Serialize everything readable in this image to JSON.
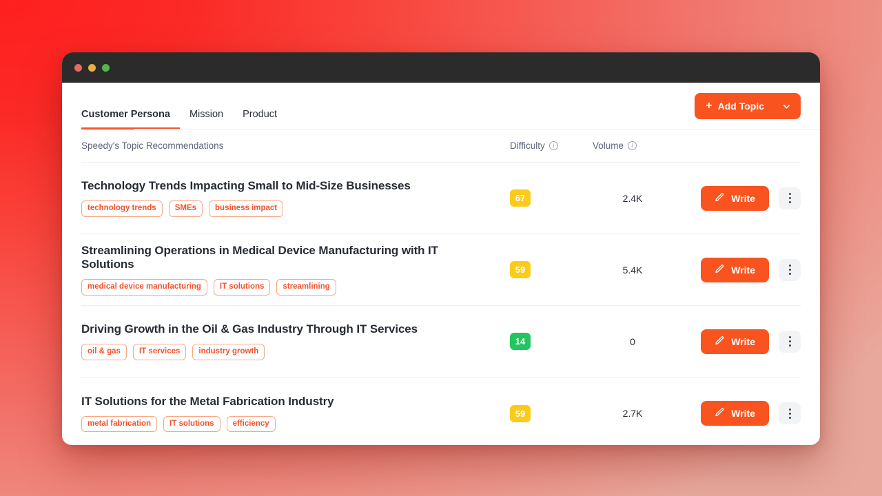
{
  "theme": {
    "accent": "#f9531f",
    "tag_border": "#f7a882",
    "tag_text": "#f4512a",
    "badge_yellow": "#fbcb1b",
    "badge_green": "#23c55e",
    "titlebar": "#2b2b2b",
    "bg_gradient_from": "#ff1f1f",
    "bg_gradient_to": "#e8a99c"
  },
  "titlebar": {
    "close_label": "close",
    "minimize_label": "minimize",
    "maximize_label": "maximize"
  },
  "tabs": [
    {
      "label": "Customer Persona",
      "active": true
    },
    {
      "label": "Mission",
      "active": false
    },
    {
      "label": "Product",
      "active": false
    }
  ],
  "add_topic": {
    "plus": "+",
    "label": "Add Topic",
    "chevron": "chevron-down"
  },
  "table": {
    "headers": {
      "title": "Speedy's Topic Recommendations",
      "difficulty": "Difficulty",
      "volume": "Volume",
      "info_glyph": "i"
    },
    "row_actions": {
      "write_label": "Write",
      "menu_label": "more-options"
    },
    "rows": [
      {
        "title": "Technology Trends Impacting Small to Mid-Size Businesses",
        "tags": [
          "technology trends",
          "SMEs",
          "business impact"
        ],
        "difficulty": "67",
        "difficulty_level": "medium",
        "volume": "2.4K"
      },
      {
        "title": "Streamlining Operations in Medical Device Manufacturing with IT Solutions",
        "tags": [
          "medical device manufacturing",
          "IT solutions",
          "streamlining"
        ],
        "difficulty": "59",
        "difficulty_level": "medium",
        "volume": "5.4K"
      },
      {
        "title": "Driving Growth in the Oil & Gas Industry Through IT Services",
        "tags": [
          "oil & gas",
          "IT services",
          "industry growth"
        ],
        "difficulty": "14",
        "difficulty_level": "low",
        "volume": "0"
      },
      {
        "title": "IT Solutions for the Metal Fabrication Industry",
        "tags": [
          "metal fabrication",
          "IT solutions",
          "efficiency"
        ],
        "difficulty": "59",
        "difficulty_level": "medium",
        "volume": "2.7K"
      }
    ]
  }
}
